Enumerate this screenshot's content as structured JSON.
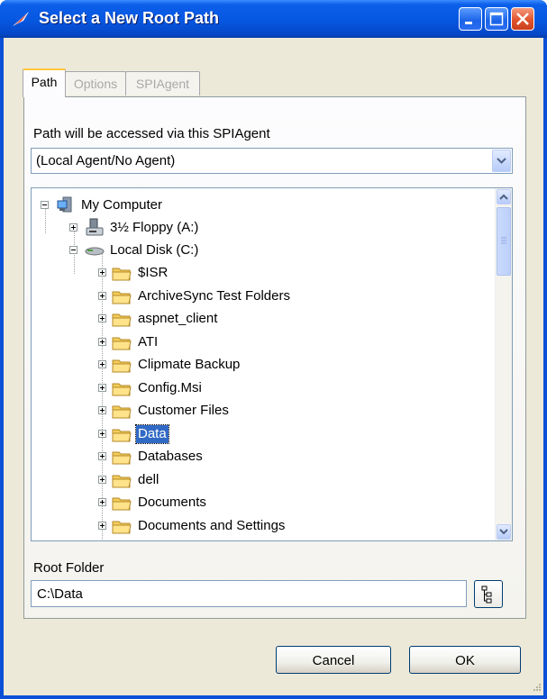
{
  "window": {
    "title": "Select a New Root Path",
    "colors": {
      "titlebar": "#0657e0",
      "client": "#ece9d8",
      "selection": "#316ac5"
    }
  },
  "tabs": [
    {
      "label": "Path",
      "active": true
    },
    {
      "label": "Options",
      "active": false
    },
    {
      "label": "SPIAgent",
      "active": false
    }
  ],
  "agent": {
    "label": "Path will be accessed via this SPIAgent",
    "selected": "(Local Agent/No Agent)"
  },
  "tree": {
    "root": {
      "label": "My Computer",
      "icon": "computer-icon"
    },
    "drives": [
      {
        "label": "3½ Floppy (A:)",
        "icon": "floppy-drive-icon"
      },
      {
        "label": "Local Disk (C:)",
        "icon": "hard-drive-icon"
      }
    ],
    "folders": [
      "$ISR",
      "ArchiveSync Test Folders",
      "aspnet_client",
      "ATI",
      "Clipmate Backup",
      "Config.Msi",
      "Customer Files",
      "Data",
      "Databases",
      "dell",
      "Documents",
      "Documents and Settings"
    ],
    "selected": "Data"
  },
  "root_folder": {
    "label": "Root Folder",
    "value": "C:\\Data"
  },
  "buttons": {
    "cancel": "Cancel",
    "ok": "OK"
  }
}
